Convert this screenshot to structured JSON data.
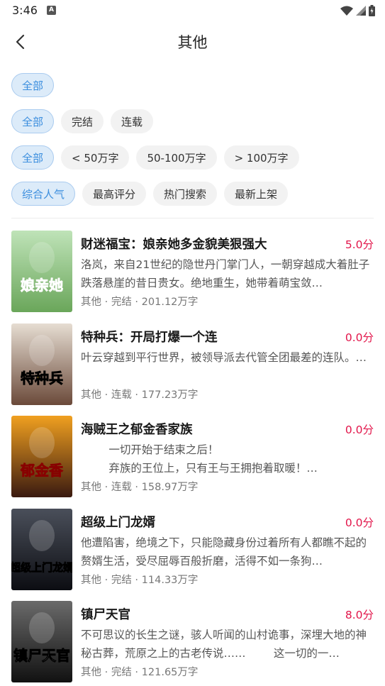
{
  "status": {
    "time": "3:46",
    "notification_letter": "A"
  },
  "nav": {
    "title": "其他"
  },
  "filters": {
    "row1": [
      {
        "label": "全部",
        "active": true
      }
    ],
    "row2": [
      {
        "label": "全部",
        "active": true
      },
      {
        "label": "完结",
        "active": false
      },
      {
        "label": "连载",
        "active": false
      }
    ],
    "row3": [
      {
        "label": "全部",
        "active": true
      },
      {
        "label": "< 50万字",
        "active": false
      },
      {
        "label": "50-100万字",
        "active": false
      },
      {
        "label": "> 100万字",
        "active": false
      }
    ],
    "row4": [
      {
        "label": "综合人气",
        "active": true
      },
      {
        "label": "最高评分",
        "active": false
      },
      {
        "label": "热门搜索",
        "active": false
      },
      {
        "label": "最新上架",
        "active": false
      }
    ]
  },
  "books": [
    {
      "title": "财迷福宝：娘亲她多金貌美狠强大",
      "score": "5.0分",
      "desc": "洛岚，来自21世纪的隐世丹门掌门人，一朝穿越成大着肚子跌落悬崖的昔日贵女。绝地重生，她带着萌宝敛…",
      "meta": "其他 · 完结 · 201.12万字",
      "cover_text": "娘亲她"
    },
    {
      "title": "特种兵：开局打爆一个连",
      "score": "0.0分",
      "desc": "叶云穿越到平行世界，被领导派去代管全团最差的连队。…",
      "meta": "其他 · 连载 · 177.23万字",
      "cover_text": "特种兵"
    },
    {
      "title": "海贼王之郁金香家族",
      "score": "0.0分",
      "desc": "        一切开始于结束之后！\n        弃族的王位上，只有王与王拥抱着取暖！…",
      "meta": "其他 · 连载 · 158.97万字",
      "cover_text": "郁金香"
    },
    {
      "title": "超级上门龙婿",
      "score": "0.0分",
      "desc": "他遭陷害，绝境之下，只能隐藏身份过着所有人都瞧不起的赘婿生活，受尽屈辱百般折磨，活得不如一条狗…",
      "meta": "其他 · 完结 · 114.33万字",
      "cover_text": "超级上门龙婿"
    },
    {
      "title": "镇尸天官",
      "score": "8.0分",
      "desc": "不可思议的长生之谜，骇人听闻的山村诡事，深埋大地的神秘古葬，荒原之上的古老传说……        这一切的一…",
      "meta": "其他 · 完结 · 121.65万字",
      "cover_text": "镇尸天官"
    }
  ],
  "colors": {
    "accent": "#3b8ede",
    "score": "#e2154a",
    "chip_bg": "#f2f2f2"
  },
  "icons": {
    "back": "chevron-left-icon",
    "wifi": "wifi-icon",
    "signal": "signal-icon",
    "battery": "battery-icon"
  }
}
